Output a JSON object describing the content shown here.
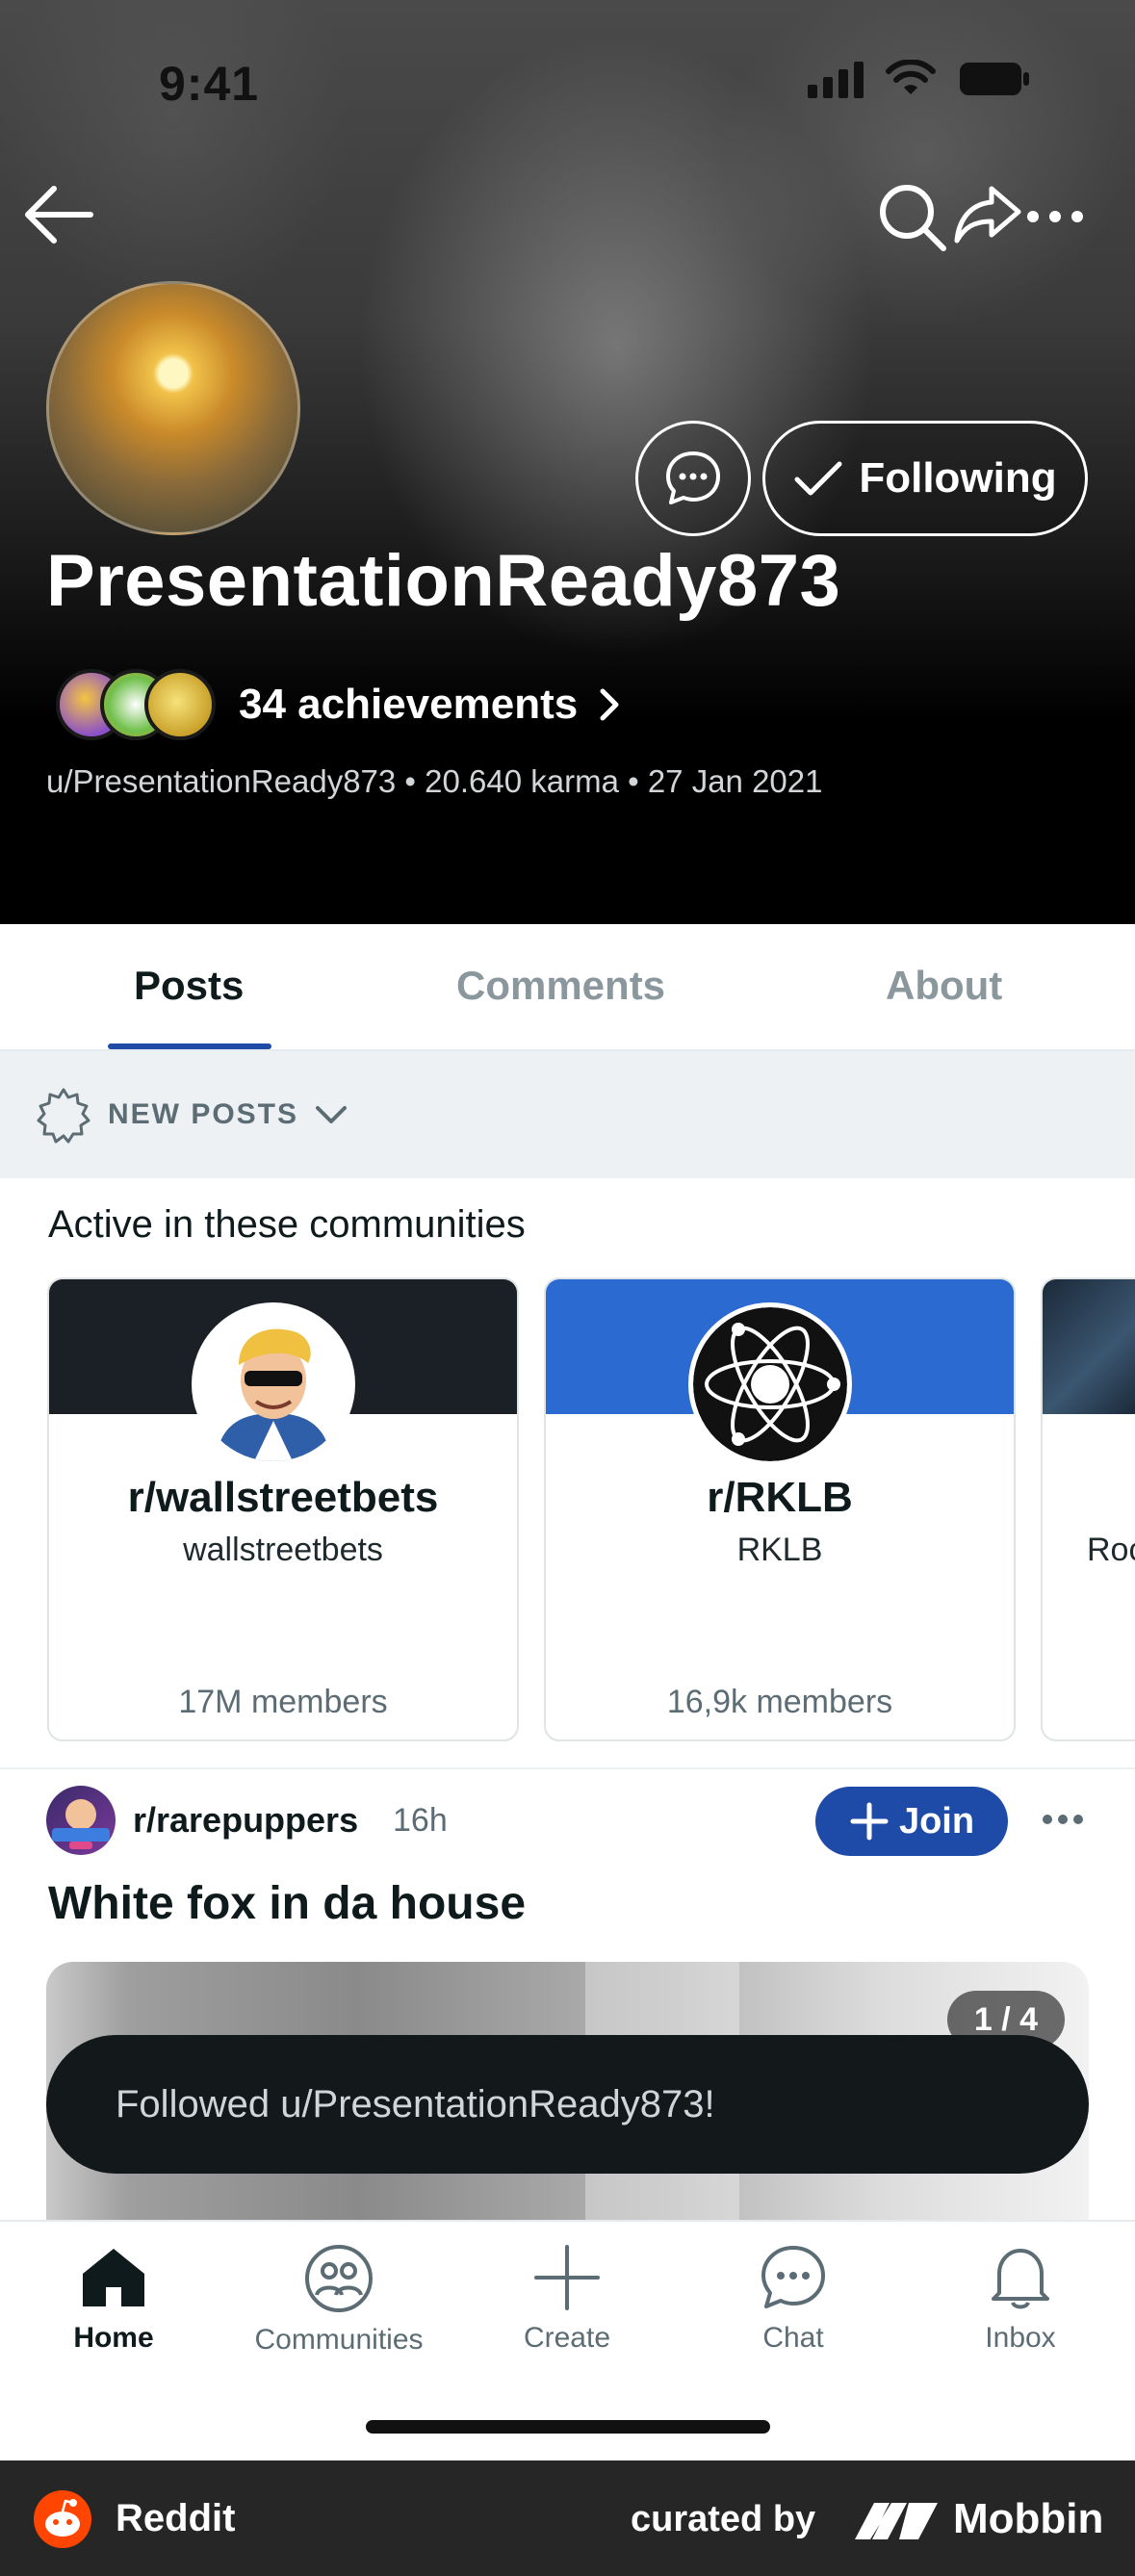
{
  "status_bar": {
    "time": "9:41"
  },
  "profile": {
    "username": "PresentationReady873",
    "achievements_label": "34 achievements",
    "meta": "u/PresentationReady873 • 20.640 karma • 27 Jan 2021",
    "following_label": "Following"
  },
  "tabs": [
    "Posts",
    "Comments",
    "About"
  ],
  "sort": {
    "label": "NEW POSTS"
  },
  "communities": {
    "title": "Active in these communities",
    "items": [
      {
        "name": "r/wallstreetbets",
        "sub": "wallstreetbets",
        "members": "17M members",
        "banner": "#1a2025"
      },
      {
        "name": "r/RKLB",
        "sub": "RKLB",
        "members": "16,9k members",
        "banner": "#2b6ad0"
      },
      {
        "name": "Roc",
        "banner": "#1b2a3a"
      }
    ]
  },
  "post": {
    "subreddit": "r/rarepuppers",
    "time": "16h",
    "join_label": "Join",
    "title": "White fox in da house",
    "image_counter": "1 / 4"
  },
  "toast": {
    "message": "Followed u/PresentationReady873!"
  },
  "bottom_nav": [
    {
      "label": "Home"
    },
    {
      "label": "Communities"
    },
    {
      "label": "Create"
    },
    {
      "label": "Chat"
    },
    {
      "label": "Inbox"
    }
  ],
  "footer": {
    "app": "Reddit",
    "curated": "curated by",
    "brand": "Mobbin"
  },
  "colors": {
    "accent": "#1f4ba8",
    "toast_bg": "#13191b",
    "footer_bg": "#262626"
  }
}
